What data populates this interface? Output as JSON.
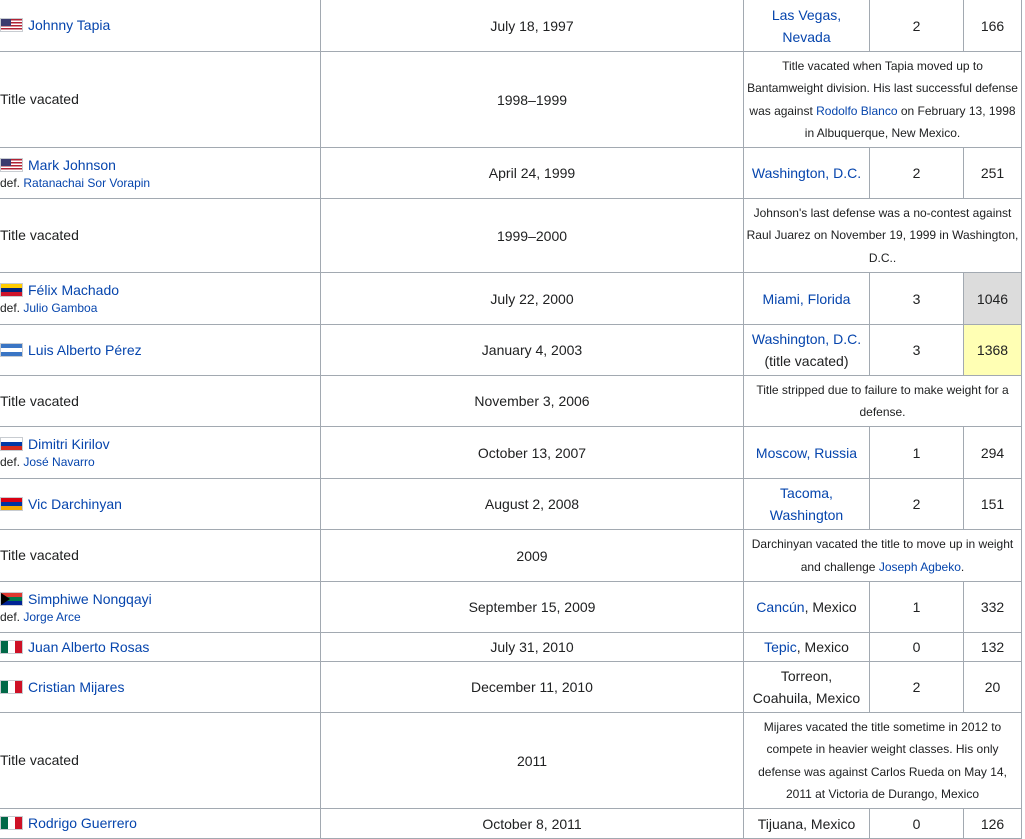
{
  "rows": [
    {
      "type": "champ",
      "flag": "us-flag",
      "name": "Johnny Tapia",
      "date": "July 18, 1997",
      "loc_link1": "Las Vegas,",
      "loc_link2": "Nevada",
      "defenses": "2",
      "days": "166"
    },
    {
      "type": "vacant",
      "label": "Title vacated",
      "period": "1998–1999",
      "note_a": "Title vacated when Tapia moved up to Bantamweight division. His last successful defense was against ",
      "note_link": "Rodolfo Blanco",
      "note_b": " on February 13, 1998 in Albuquerque, New Mexico."
    },
    {
      "type": "champ",
      "flag": "us-flag",
      "name": "Mark Johnson",
      "def_prefix": "def. ",
      "def_name": "Ratanachai Sor Vorapin",
      "date": "April 24, 1999",
      "loc_link1": "Washington, D.C.",
      "defenses": "2",
      "days": "251"
    },
    {
      "type": "vacant",
      "label": "Title vacated",
      "period": "1999–2000",
      "note_a": "Johnson's last defense was a no-contest against Raul Juarez on November 19, 1999 in Washington, D.C.."
    },
    {
      "type": "champ",
      "flag": "venezuela-flag",
      "name": "Félix Machado",
      "def_prefix": "def. ",
      "def_name": "Julio Gamboa",
      "date": "July 22, 2000",
      "loc_link1": "Miami, Florida",
      "defenses": "3",
      "days": "1046"
    },
    {
      "type": "champ",
      "flag": "nicaragua-flag",
      "name": "Luis Alberto Pérez",
      "date": "January 4, 2003",
      "loc_link1": "Washington, D.C.",
      "loc_text2": "(title vacated)",
      "defenses": "3",
      "days": "1368"
    },
    {
      "type": "vacant",
      "label": "Title vacated",
      "period": "November 3, 2006",
      "note_a": "Title stripped due to failure to make weight for a defense."
    },
    {
      "type": "champ",
      "flag": "russia-flag",
      "name": "Dimitri Kirilov",
      "def_prefix": "def. ",
      "def_name": "José Navarro",
      "date": "October 13, 2007",
      "loc_link1": "Moscow, Russia",
      "defenses": "1",
      "days": "294"
    },
    {
      "type": "champ",
      "flag": "armenia-flag",
      "name": "Vic Darchinyan",
      "date": "August 2, 2008",
      "loc_link1": "Tacoma,",
      "loc_link2": "Washington",
      "defenses": "2",
      "days": "151"
    },
    {
      "type": "vacant",
      "label": "Title vacated",
      "period": "2009",
      "note_a": "Darchinyan vacated the title to move up in weight and challenge ",
      "note_link": "Joseph Agbeko",
      "note_b": "."
    },
    {
      "type": "champ",
      "flag": "south-africa-flag",
      "name": "Simphiwe Nongqayi",
      "def_prefix": "def. ",
      "def_name": "Jorge Arce",
      "date": "September 15, 2009",
      "loc_link1": "Cancún",
      "loc_text1": ", Mexico",
      "defenses": "1",
      "days": "332"
    },
    {
      "type": "champ",
      "flag": "mexico-flag",
      "name": "Juan Alberto Rosas",
      "date": "July 31, 2010",
      "loc_link1": "Tepic",
      "loc_text1": ", Mexico",
      "defenses": "0",
      "days": "132"
    },
    {
      "type": "champ",
      "flag": "mexico-flag",
      "name": "Cristian Mijares",
      "date": "December 11, 2010",
      "loc_text1": "Torreon,",
      "loc_text2": "Coahuila, Mexico",
      "defenses": "2",
      "days": "20"
    },
    {
      "type": "vacant",
      "label": "Title vacated",
      "period": "2011",
      "note_a": "Mijares vacated the title sometime in 2012 to compete in heavier weight classes. His only defense was against Carlos Rueda on May 14, 2011 at Victoria de Durango, Mexico"
    },
    {
      "type": "champ",
      "flag": "mexico-flag",
      "name": "Rodrigo Guerrero",
      "date": "October 8, 2011",
      "loc_text1": "Tijuana, Mexico",
      "defenses": "0",
      "days": "126"
    }
  ],
  "colors": {
    "link": "#0645ad",
    "border": "#a2a9b1",
    "highlight_gray": "#dcdcdc",
    "highlight_yellow": "#ffffb4"
  }
}
